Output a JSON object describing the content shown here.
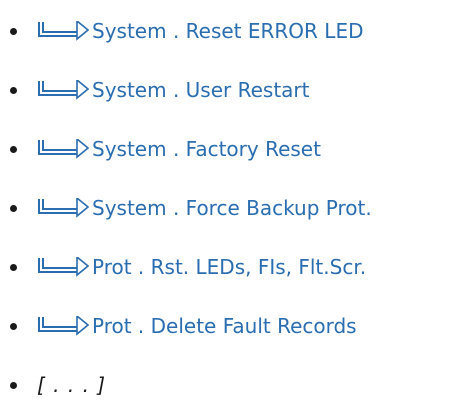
{
  "items": [
    {
      "label": "System . Reset ERROR LED",
      "icon": "arrow-return-icon"
    },
    {
      "label": "System . User Restart",
      "icon": "arrow-return-icon"
    },
    {
      "label": "System . Factory Reset",
      "icon": "arrow-return-icon"
    },
    {
      "label": "System . Force Backup Prot.",
      "icon": "arrow-return-icon"
    },
    {
      "label": "Prot . Rst. LEDs, FIs, Flt.Scr.",
      "icon": "arrow-return-icon"
    },
    {
      "label": "Prot . Delete Fault Records",
      "icon": "arrow-return-icon"
    }
  ],
  "more": "[ . . . ]",
  "colors": {
    "link": "#2a6db0",
    "icon": "#2a6db0",
    "bullet": "#1a1a1a"
  }
}
